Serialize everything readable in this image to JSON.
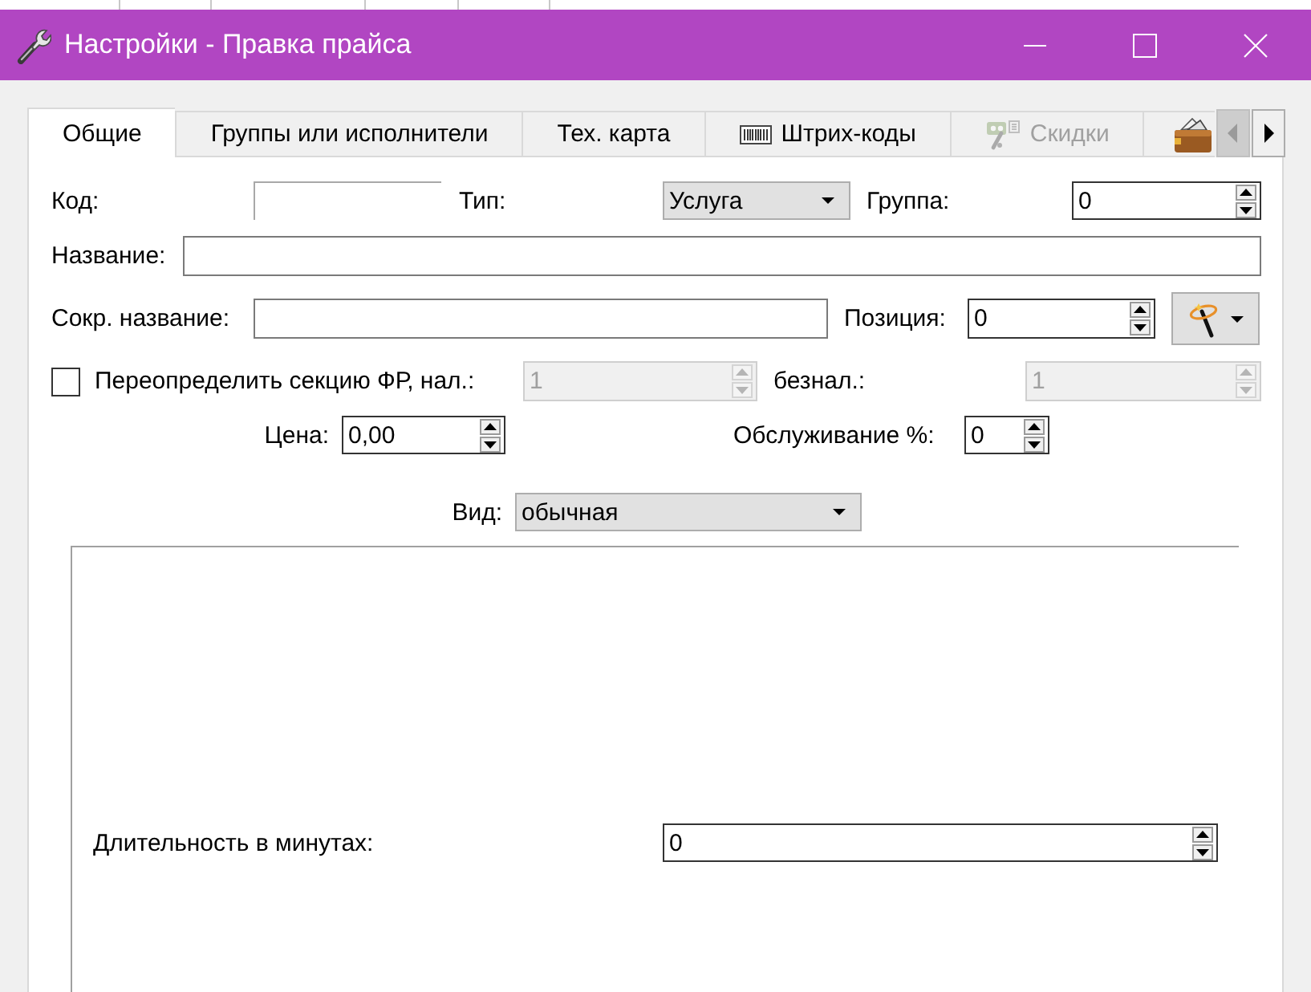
{
  "window": {
    "title": "Настройки - Правка прайса"
  },
  "tabs": [
    {
      "kind": "text",
      "label": "Общие",
      "selected": true,
      "disabled": false
    },
    {
      "kind": "text",
      "label": "Группы или исполнители",
      "selected": false,
      "disabled": false
    },
    {
      "kind": "text",
      "label": "Тех. карта",
      "selected": false,
      "disabled": false
    },
    {
      "kind": "barcode",
      "label": "Штрих-коды",
      "selected": false,
      "disabled": false
    },
    {
      "kind": "discount",
      "label": "Скидки",
      "selected": false,
      "disabled": true
    },
    {
      "kind": "wallet",
      "selected": false,
      "disabled": false
    }
  ],
  "tab_scroll": [
    {
      "kind": "left",
      "disabled": true
    },
    {
      "kind": "right",
      "disabled": false
    }
  ],
  "code": {
    "label": "Код:"
  },
  "type": {
    "label": "Тип:",
    "value": "Услуга"
  },
  "group": {
    "label": "Группа:",
    "value": "0"
  },
  "name": {
    "label": "Название:"
  },
  "short_name": {
    "label": "Сокр. название:"
  },
  "position": {
    "label": "Позиция:",
    "value": "0"
  },
  "fiscal_section": {
    "label": "Переопределить секцию ФР, нал.:",
    "checked": false,
    "cash": {
      "value": "1",
      "disabled": true
    },
    "cashless_label": "безнал.:",
    "cashless": {
      "value": "1",
      "disabled": true
    }
  },
  "price": {
    "label": "Цена:",
    "value": "0,00"
  },
  "service": {
    "label": "Обслуживание %:",
    "value": "0"
  },
  "view": {
    "label": "Вид:",
    "value": "обычная"
  },
  "duration": {
    "label": "Длительность в минутах:",
    "value": "0"
  }
}
